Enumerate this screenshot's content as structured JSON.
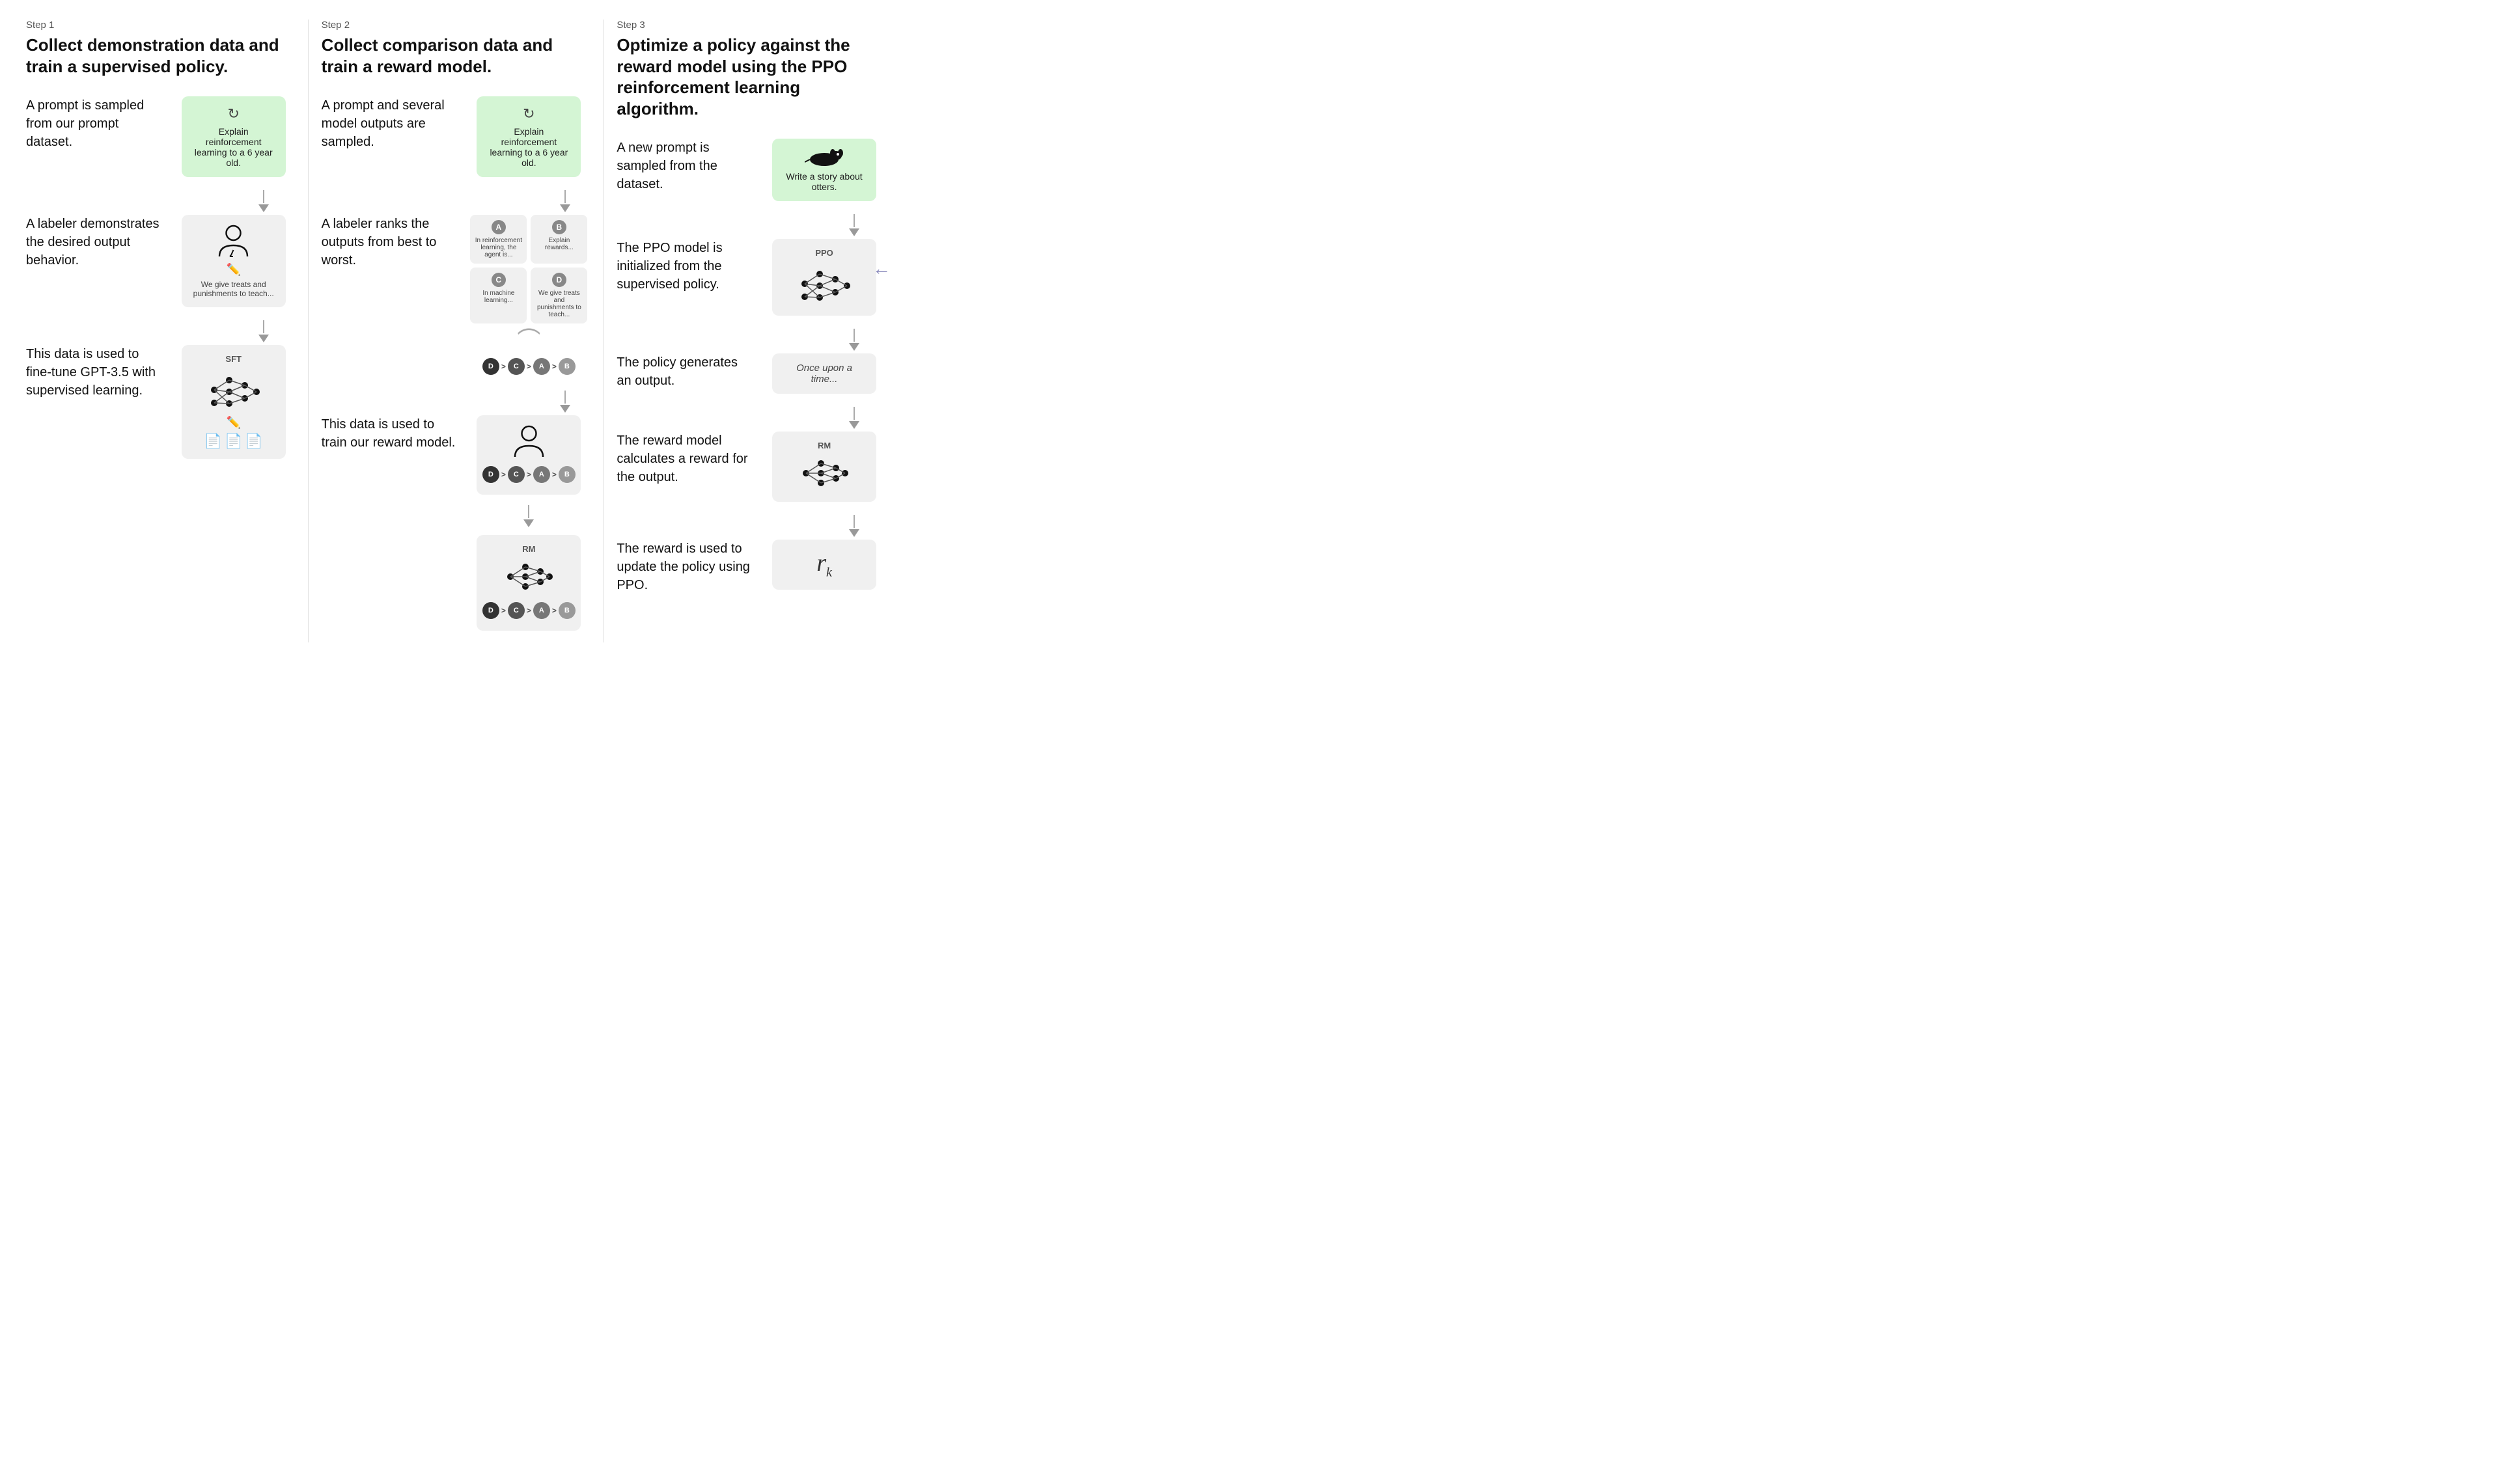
{
  "steps": [
    {
      "label": "Step 1",
      "title": "Collect demonstration data and train a supervised policy.",
      "rows": [
        {
          "text": "A prompt is sampled from our prompt dataset.",
          "diag_type": "prompt_box",
          "prompt_text": "Explain reinforcement learning to a 6 year old."
        },
        {
          "text": "A labeler demonstrates the desired output behavior.",
          "diag_type": "person_pencil",
          "caption": "We give treats and punishments to teach..."
        },
        {
          "text": "This data is used to fine-tune GPT-3.5 with supervised learning.",
          "diag_type": "sft_network",
          "label": "SFT"
        }
      ]
    },
    {
      "label": "Step 2",
      "title": "Collect comparison data and train a reward model.",
      "rows": [
        {
          "text": "A prompt and several model outputs are sampled.",
          "diag_type": "prompt_box",
          "prompt_text": "Explain reinforcement learning to a 6 year old."
        },
        {
          "text": "A labeler ranks the outputs from best to worst.",
          "diag_type": "outputs_grid",
          "outputs": [
            {
              "label": "A",
              "text": "In reinforcement learning, the agent is..."
            },
            {
              "label": "B",
              "text": "Explain rewards..."
            },
            {
              "label": "C",
              "text": "In machine learning..."
            },
            {
              "label": "D",
              "text": "We give treats and punishments to teach..."
            }
          ],
          "rank": [
            "D",
            "C",
            "A",
            "B"
          ]
        },
        {
          "text": "This data is used to train our reward model.",
          "diag_type": "rm_network",
          "label": "RM",
          "rank": [
            "D",
            "C",
            "A",
            "B"
          ]
        }
      ]
    },
    {
      "label": "Step 3",
      "title": "Optimize a policy against the reward model using the PPO reinforcement learning algorithm.",
      "rows": [
        {
          "text": "A new prompt is sampled from the dataset.",
          "diag_type": "prompt_box",
          "prompt_text": "Write a story about otters."
        },
        {
          "text": "The PPO model is initialized from the supervised policy.",
          "diag_type": "ppo_network",
          "label": "PPO"
        },
        {
          "text": "The policy generates an output.",
          "diag_type": "text_output",
          "output_text": "Once upon a time..."
        },
        {
          "text": "The reward model calculates a reward for the output.",
          "diag_type": "rm_network2",
          "label": "RM"
        },
        {
          "text": "The reward is used to update the policy using PPO.",
          "diag_type": "rk",
          "label": "r",
          "sub": "k"
        }
      ]
    }
  ],
  "icons": {
    "refresh": "↻",
    "person": "👤",
    "pencil": "✏",
    "doc": "📄"
  }
}
